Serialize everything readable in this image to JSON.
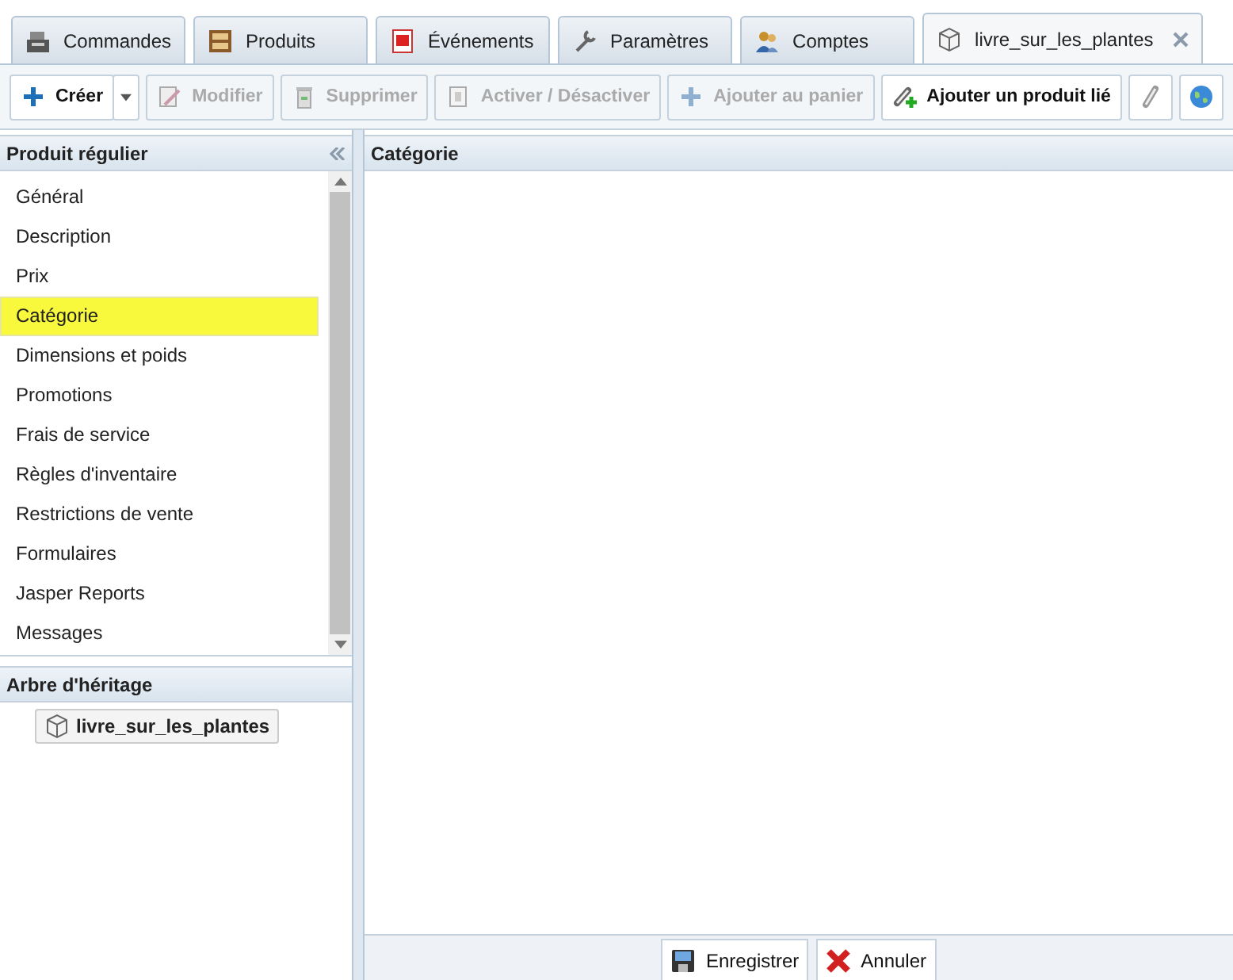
{
  "tabs": [
    {
      "label": "Commandes",
      "selected": false
    },
    {
      "label": "Produits",
      "selected": false
    },
    {
      "label": "Événements",
      "selected": false
    },
    {
      "label": "Paramètres",
      "selected": false
    },
    {
      "label": "Comptes",
      "selected": false
    },
    {
      "label": "livre_sur_les_plantes",
      "selected": true
    }
  ],
  "toolbar": [
    {
      "label": "Créer",
      "disabled": false
    },
    {
      "label": "Modifier",
      "disabled": true
    },
    {
      "label": "Supprimer",
      "disabled": true
    },
    {
      "label": "Activer / Désactiver",
      "disabled": true
    },
    {
      "label": "Ajouter au panier",
      "disabled": true
    },
    {
      "label": "Ajouter un produit lié",
      "disabled": false
    }
  ],
  "sidebar": {
    "title": "Produit régulier",
    "items": [
      {
        "label": "Général",
        "selected": false
      },
      {
        "label": "Description",
        "selected": false
      },
      {
        "label": "Prix",
        "selected": false
      },
      {
        "label": "Catégorie",
        "selected": true
      },
      {
        "label": "Dimensions et poids",
        "selected": false
      },
      {
        "label": "Promotions",
        "selected": false
      },
      {
        "label": "Frais de service",
        "selected": false
      },
      {
        "label": "Règles d'inventaire",
        "selected": false
      },
      {
        "label": "Restrictions de vente",
        "selected": false
      },
      {
        "label": "Formulaires",
        "selected": false
      },
      {
        "label": "Jasper Reports",
        "selected": false
      },
      {
        "label": "Messages",
        "selected": false
      }
    ]
  },
  "inheritance": {
    "title": "Arbre d'héritage",
    "node": "livre_sur_les_plantes"
  },
  "main": {
    "title": "Catégorie"
  },
  "footer_buttons": [
    "Enregistrer",
    "Annuler"
  ]
}
